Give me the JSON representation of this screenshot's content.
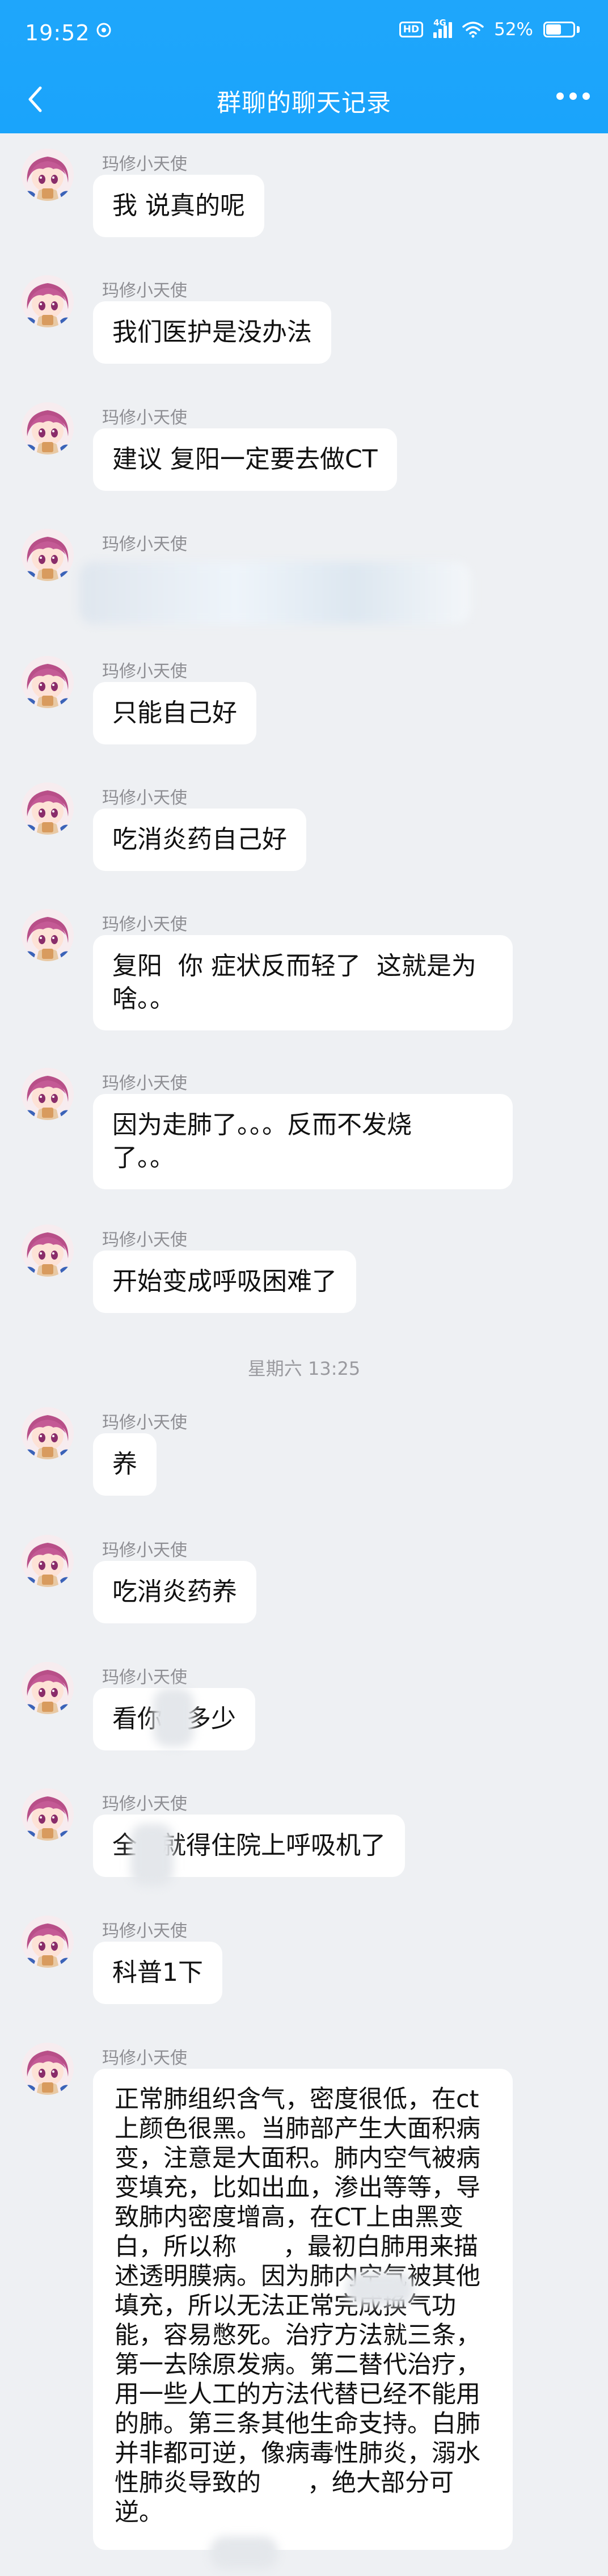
{
  "status_bar": {
    "time": "19:52",
    "network": "4G",
    "battery": "52%",
    "hd_label": "HD"
  },
  "nav": {
    "title": "群聊的聊天记录"
  },
  "colors": {
    "header": "#1fa6fb",
    "background": "#eef0f3",
    "bubble": "#ffffff"
  },
  "sender_name": "玛修小天使",
  "messages": [
    {
      "text": "我 说真的呢"
    },
    {
      "text": "我们医护是没办法"
    },
    {
      "text": "建议 复阳一定要去做CT"
    },
    {
      "text": ""
    },
    {
      "text": "只能自己好"
    },
    {
      "text": "吃消炎药自己好"
    },
    {
      "text": "复阳  你 症状反而轻了  这就是为\n啥。。"
    },
    {
      "text": "因为走肺了。。。反而不发烧\n了。。"
    },
    {
      "text": "开始变成呼吸困难了"
    },
    {
      "text": "养"
    },
    {
      "text": "吃消炎药养"
    },
    {
      "text": "看你   多少"
    },
    {
      "text": "全   就得住院上呼吸机了"
    },
    {
      "text": "科普1下"
    },
    {
      "text": "正常肺组织含气，密度很低，在ct上颜色很黑。当肺部产生大面积病变，注意是大面积。肺内空气被病变填充，比如出血，渗出等等，导致肺内密度增高，在CT上由黑变白，所以称      ，最初白肺用来描述透明膜病。因为肺内空气被其他填充，所以无法正常完成换气功能，容易憋死。治疗方法就三条，第一去除原发病。第二替代治疗，用一些人工的方法代替已经不能用的肺。第三条其他生命支持。白肺并非都可逆，像病毒性肺炎，溺水性肺炎导致的      ，绝大部分可逆。"
    }
  ],
  "timestamp": "星期六 13:25"
}
